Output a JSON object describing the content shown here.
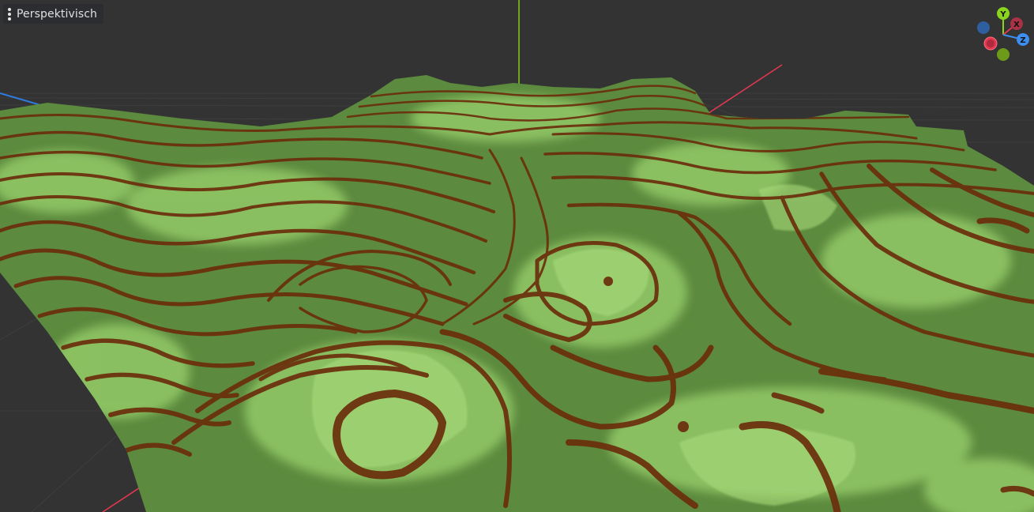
{
  "viewport": {
    "view_mode_label": "Perspektivisch",
    "background_color": "#333333",
    "terrain": {
      "base_color": "#5c8a3e",
      "highlight_color": "#9fd472",
      "contour_color": "#6b2e0c"
    },
    "axis_colors": {
      "x": "#e0384f",
      "y": "#7fc31c",
      "z": "#2f7ce0"
    }
  },
  "gizmo": {
    "x_label": "X",
    "y_label": "Y",
    "z_label": "Z",
    "x_color": "#e0384f",
    "y_color": "#8bd41d",
    "z_color": "#3c8ef0"
  }
}
